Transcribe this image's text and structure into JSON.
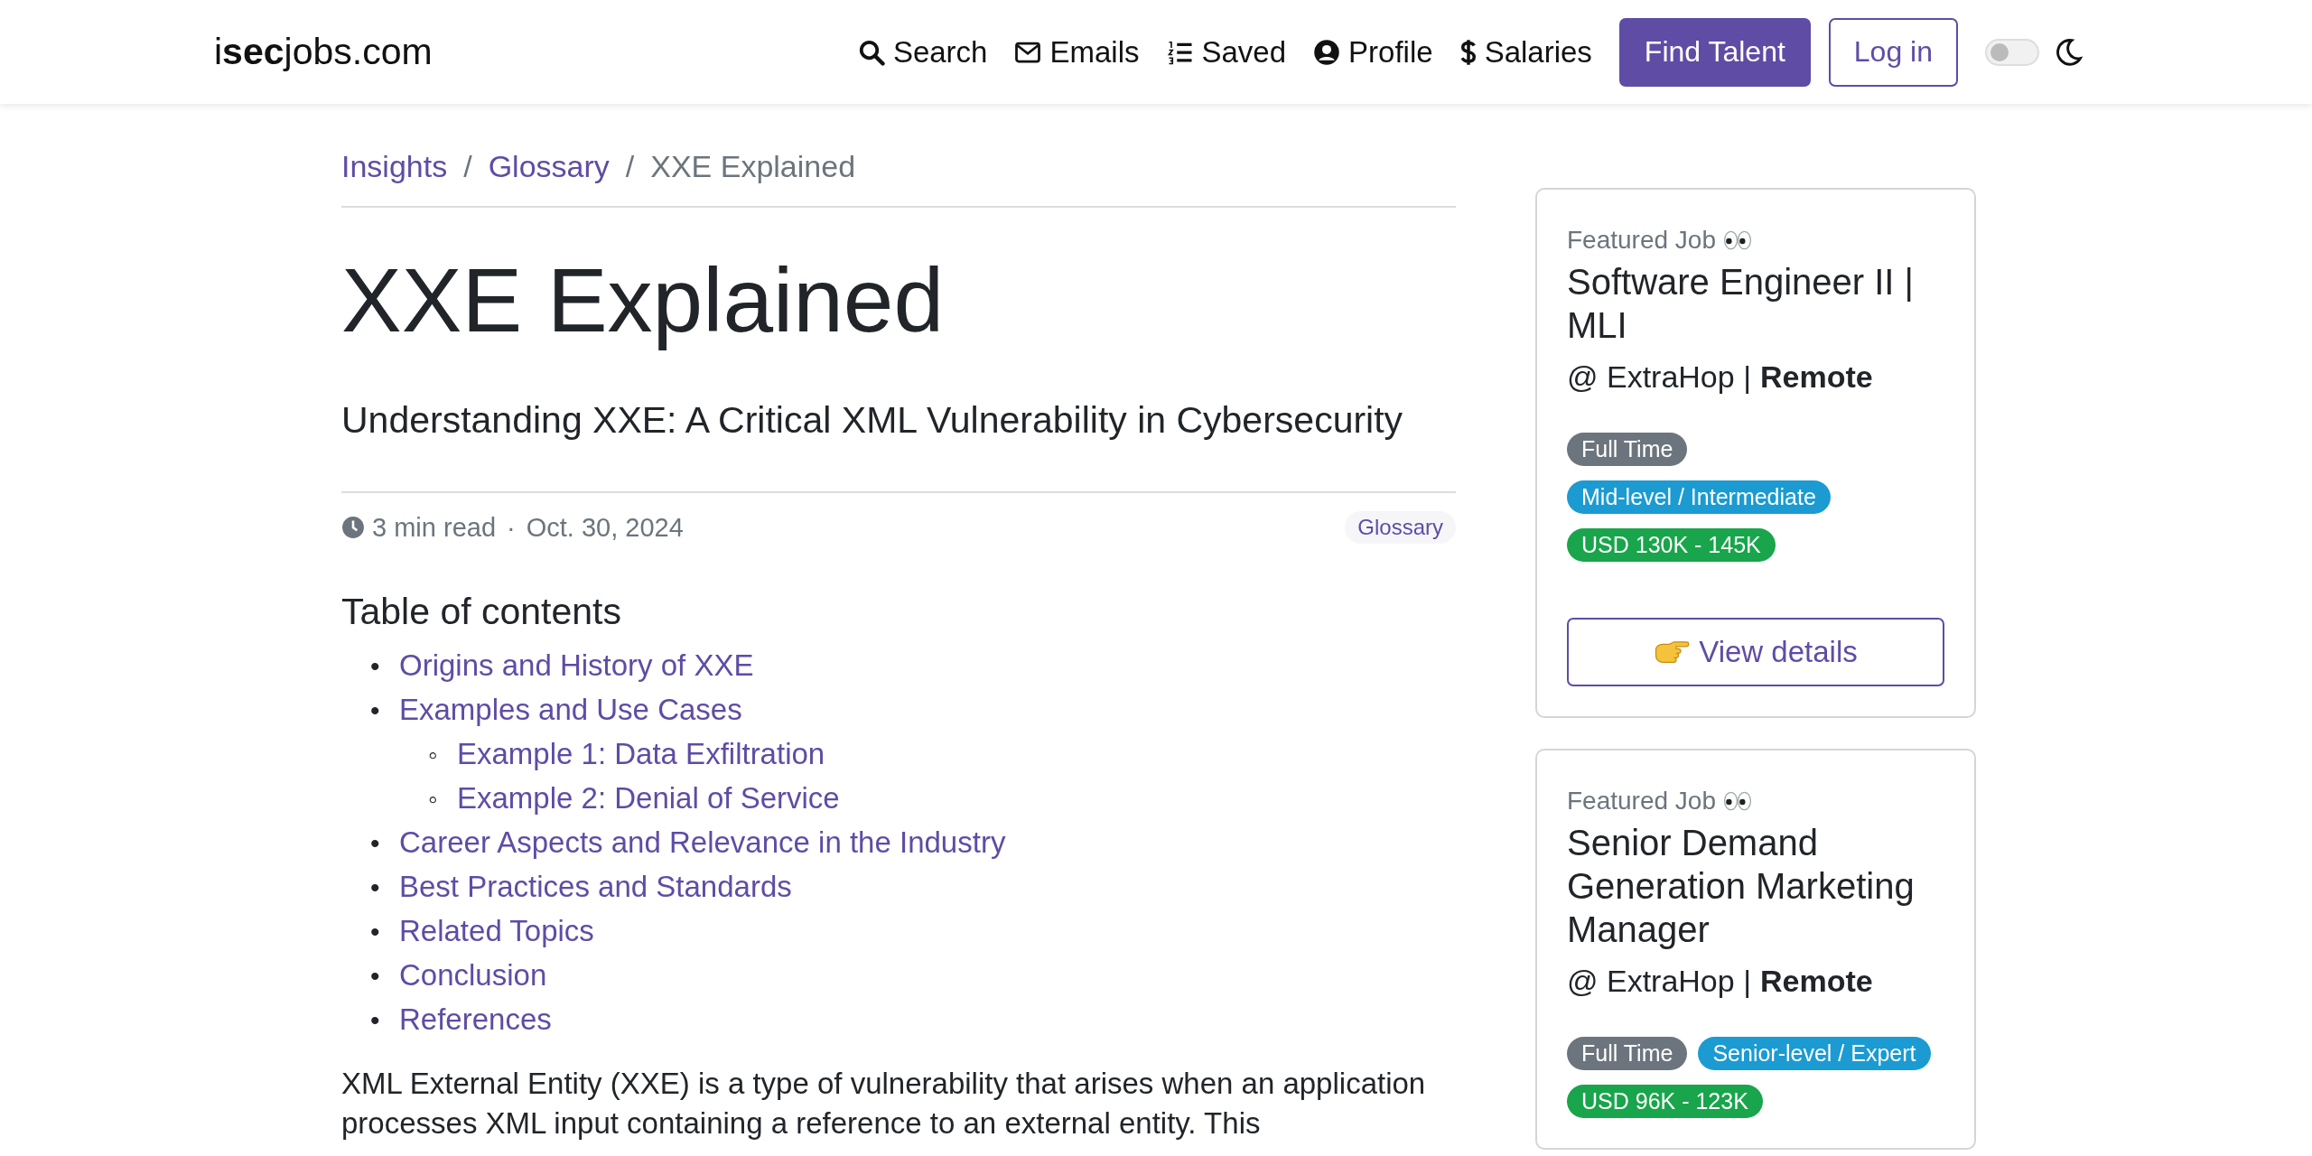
{
  "header": {
    "logo": "i**sec**jobs.com",
    "nav": [
      {
        "label": "Search"
      },
      {
        "label": "Emails"
      },
      {
        "label": "Saved"
      },
      {
        "label": "Profile"
      },
      {
        "label": "Salaries"
      }
    ],
    "buttons": [
      {
        "label": "Find Talent",
        "kind": "primary"
      },
      {
        "label": "Log in",
        "kind": "outline"
      }
    ],
    "theme_toggle": {
      "on": false
    }
  },
  "breadcrumb": [
    {
      "label": "Insights",
      "link": true
    },
    {
      "separator": "/"
    },
    {
      "label": "Glossary",
      "link": true
    },
    {
      "separator": "/"
    },
    {
      "label": "XXE Explained",
      "link": false
    }
  ],
  "title": "XXE Explained",
  "subtitle": "Understanding XXE: A Critical XML Vulnerability in Cybersecurity",
  "meta": {
    "read_time": "3 min read",
    "separator": "·",
    "date": "Oct. 30, 2024",
    "tag": "Glossary"
  },
  "toc": {
    "heading": "Table of contents",
    "items": [
      {
        "marker": "•",
        "label": "Origins and History of XXE"
      },
      {
        "marker": "•",
        "label": "Examples and Use Cases",
        "children": [
          {
            "marker": "◦",
            "label": "Example 1: Data Exfiltration"
          },
          {
            "marker": "◦",
            "label": "Example 2: Denial of Service"
          }
        ]
      },
      {
        "marker": "•",
        "label": "Career Aspects and Relevance in the Industry"
      },
      {
        "marker": "•",
        "label": "Best Practices and Standards"
      },
      {
        "marker": "•",
        "label": "Related Topics"
      },
      {
        "marker": "•",
        "label": "Conclusion"
      },
      {
        "marker": "•",
        "label": "References"
      }
    ]
  },
  "paragraph": "XML External Entity (XXE) is a type of vulnerability that arises when an application processes XML input containing a reference to an external entity. This",
  "featured_jobs": [
    {
      "kicker": "Featured Job",
      "title": "Software Engineer II | MLI",
      "company": "@ ExtraHop |",
      "location": "Remote",
      "tags": [
        {
          "label": "Full Time",
          "kind": "type"
        },
        {
          "label": "Mid-level / Intermediate",
          "kind": "level"
        },
        {
          "label": "USD 130K - 145K",
          "kind": "salary"
        }
      ],
      "button": "View details"
    },
    {
      "kicker": "Featured Job",
      "title": "Senior Demand Generation Marketing Manager",
      "company": "@ ExtraHop |",
      "location": "Remote",
      "tags": [
        {
          "label": "Full Time",
          "kind": "type"
        },
        {
          "label": "Senior-level / Expert",
          "kind": "level"
        },
        {
          "label": "USD 96K - 123K",
          "kind": "salary"
        }
      ]
    }
  ]
}
